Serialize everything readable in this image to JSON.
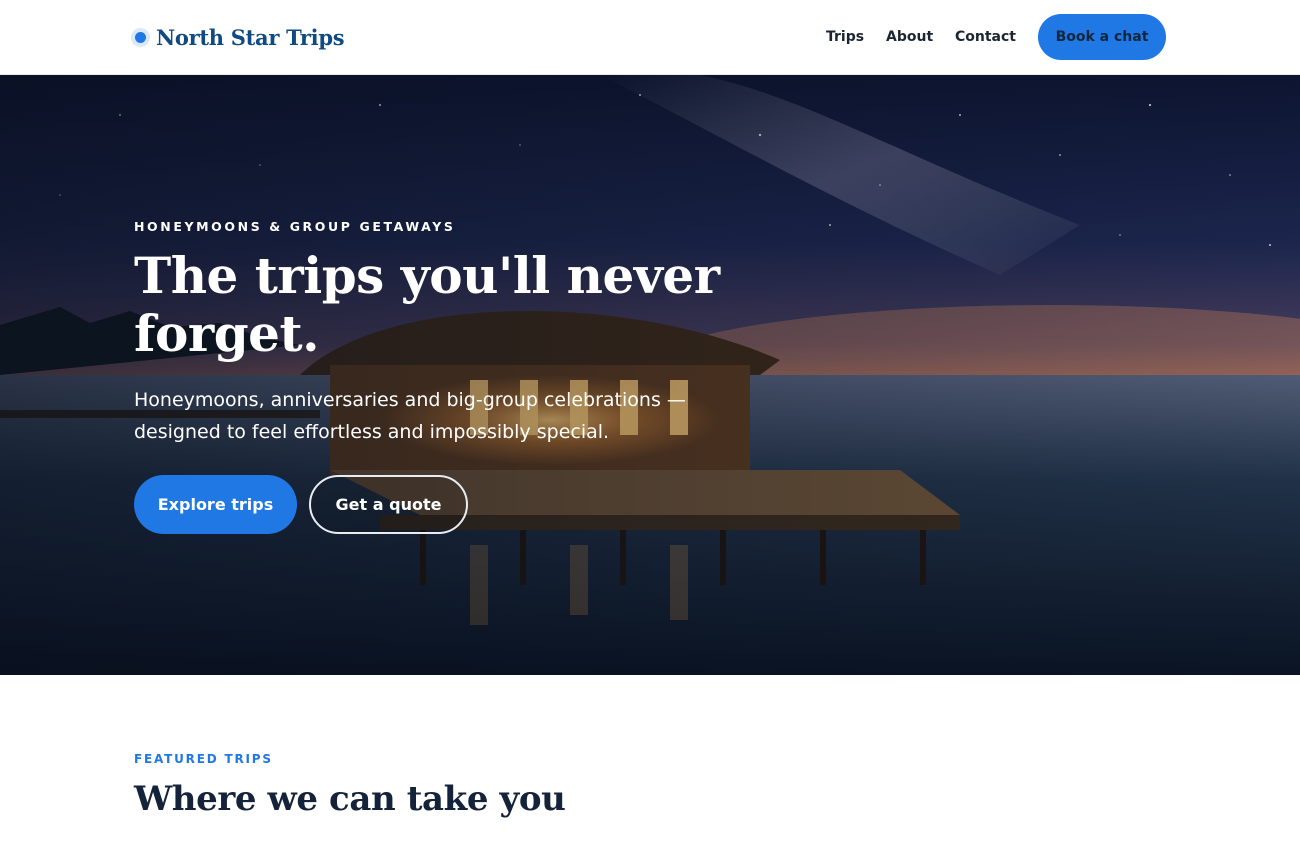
{
  "header": {
    "brand_name": "North Star Trips",
    "nav": [
      {
        "label": "Trips"
      },
      {
        "label": "About"
      },
      {
        "label": "Contact"
      }
    ],
    "cta_label": "Book a chat"
  },
  "hero": {
    "eyebrow": "HONEYMOONS & GROUP GETAWAYS",
    "title": "The trips you'll never forget.",
    "subtitle": "Honeymoons, anniversaries and big-group celebrations — designed to feel effortless and impossibly special.",
    "primary_button": "Explore trips",
    "secondary_button": "Get a quote"
  },
  "featured": {
    "eyebrow": "FEATURED TRIPS",
    "title": "Where we can take you"
  },
  "colors": {
    "accent": "#1f78e4",
    "brand": "#0f4a82",
    "heading": "#14233a"
  },
  "icons": {
    "brand_mark": "star-dot-icon"
  }
}
